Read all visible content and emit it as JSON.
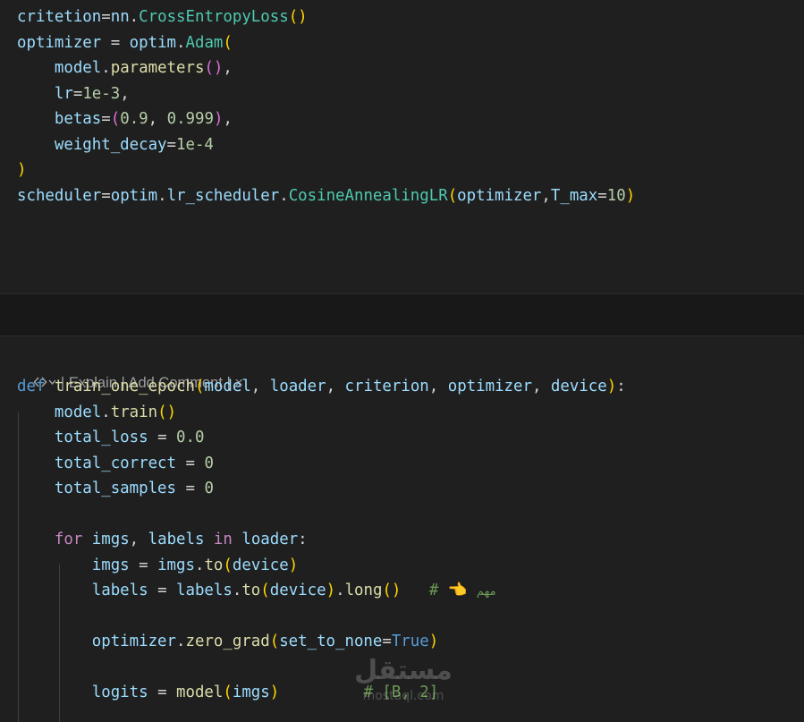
{
  "top_cell": {
    "lines": [
      [
        [
          "v",
          "critetion"
        ],
        [
          "p",
          "="
        ],
        [
          "v",
          "nn"
        ],
        [
          "p",
          "."
        ],
        [
          "c",
          "CrossEntropyLoss"
        ],
        [
          "b1",
          "()"
        ]
      ],
      [
        [
          "v",
          "optimizer"
        ],
        [
          "p",
          " = "
        ],
        [
          "v",
          "optim"
        ],
        [
          "p",
          "."
        ],
        [
          "c",
          "Adam"
        ],
        [
          "b1",
          "("
        ]
      ],
      [
        [
          "p",
          "    "
        ],
        [
          "v",
          "model"
        ],
        [
          "p",
          "."
        ],
        [
          "f",
          "parameters"
        ],
        [
          "b2",
          "()"
        ],
        [
          "p",
          ","
        ]
      ],
      [
        [
          "p",
          "    "
        ],
        [
          "v",
          "lr"
        ],
        [
          "p",
          "="
        ],
        [
          "n",
          "1e-3"
        ],
        [
          "p",
          ","
        ]
      ],
      [
        [
          "p",
          "    "
        ],
        [
          "v",
          "betas"
        ],
        [
          "p",
          "="
        ],
        [
          "b2",
          "("
        ],
        [
          "n",
          "0.9"
        ],
        [
          "p",
          ", "
        ],
        [
          "n",
          "0.999"
        ],
        [
          "b2",
          ")"
        ],
        [
          "p",
          ","
        ]
      ],
      [
        [
          "p",
          "    "
        ],
        [
          "v",
          "weight_decay"
        ],
        [
          "p",
          "="
        ],
        [
          "n",
          "1e-4"
        ]
      ],
      [
        [
          "b1",
          ")"
        ]
      ],
      [
        [
          "v",
          "scheduler"
        ],
        [
          "p",
          "="
        ],
        [
          "v",
          "optim"
        ],
        [
          "p",
          "."
        ],
        [
          "v",
          "lr_scheduler"
        ],
        [
          "p",
          "."
        ],
        [
          "c",
          "CosineAnnealingLR"
        ],
        [
          "b1",
          "("
        ],
        [
          "v",
          "optimizer"
        ],
        [
          "p",
          ","
        ],
        [
          "v",
          "T_max"
        ],
        [
          "p",
          "="
        ],
        [
          "n",
          "10"
        ],
        [
          "b1",
          ")"
        ]
      ]
    ]
  },
  "codelens": {
    "icon": "code-compare-icon",
    "separator": " | ",
    "explain_label": "Explain",
    "add_comment_label": "Add Comment",
    "close_glyph": "×"
  },
  "bottom_cell": {
    "lines": [
      [
        [
          "k",
          "def "
        ],
        [
          "f",
          "train_one_epoch"
        ],
        [
          "b1",
          "("
        ],
        [
          "v",
          "model"
        ],
        [
          "p",
          ", "
        ],
        [
          "v",
          "loader"
        ],
        [
          "p",
          ", "
        ],
        [
          "v",
          "criterion"
        ],
        [
          "p",
          ", "
        ],
        [
          "v",
          "optimizer"
        ],
        [
          "p",
          ", "
        ],
        [
          "v",
          "device"
        ],
        [
          "b1",
          ")"
        ],
        [
          "p",
          ":"
        ]
      ],
      [
        [
          "p",
          "    "
        ],
        [
          "v",
          "model"
        ],
        [
          "p",
          "."
        ],
        [
          "f",
          "train"
        ],
        [
          "b1",
          "()"
        ]
      ],
      [
        [
          "p",
          "    "
        ],
        [
          "v",
          "total_loss"
        ],
        [
          "p",
          " = "
        ],
        [
          "n",
          "0.0"
        ]
      ],
      [
        [
          "p",
          "    "
        ],
        [
          "v",
          "total_correct"
        ],
        [
          "p",
          " = "
        ],
        [
          "n",
          "0"
        ]
      ],
      [
        [
          "p",
          "    "
        ],
        [
          "v",
          "total_samples"
        ],
        [
          "p",
          " = "
        ],
        [
          "n",
          "0"
        ]
      ],
      [],
      [
        [
          "p",
          "    "
        ],
        [
          "kc",
          "for "
        ],
        [
          "v",
          "imgs"
        ],
        [
          "p",
          ", "
        ],
        [
          "v",
          "labels"
        ],
        [
          "kc",
          " in "
        ],
        [
          "v",
          "loader"
        ],
        [
          "p",
          ":"
        ]
      ],
      [
        [
          "p",
          "        "
        ],
        [
          "v",
          "imgs"
        ],
        [
          "p",
          " = "
        ],
        [
          "v",
          "imgs"
        ],
        [
          "p",
          "."
        ],
        [
          "f",
          "to"
        ],
        [
          "b1",
          "("
        ],
        [
          "v",
          "device"
        ],
        [
          "b1",
          ")"
        ]
      ],
      [
        [
          "p",
          "        "
        ],
        [
          "v",
          "labels"
        ],
        [
          "p",
          " = "
        ],
        [
          "v",
          "labels"
        ],
        [
          "p",
          "."
        ],
        [
          "f",
          "to"
        ],
        [
          "b1",
          "("
        ],
        [
          "v",
          "device"
        ],
        [
          "b1",
          ")"
        ],
        [
          "p",
          "."
        ],
        [
          "f",
          "long"
        ],
        [
          "b1",
          "()"
        ],
        [
          "p",
          "   "
        ],
        [
          "cm",
          "# "
        ],
        [
          "emoji",
          "👈"
        ],
        [
          "p",
          " "
        ],
        [
          "arabic",
          "مهم"
        ]
      ],
      [],
      [
        [
          "p",
          "        "
        ],
        [
          "v",
          "optimizer"
        ],
        [
          "p",
          "."
        ],
        [
          "f",
          "zero_grad"
        ],
        [
          "b1",
          "("
        ],
        [
          "v",
          "set_to_none"
        ],
        [
          "p",
          "="
        ],
        [
          "k",
          "True"
        ],
        [
          "b1",
          ")"
        ]
      ],
      [],
      [
        [
          "p",
          "        "
        ],
        [
          "v",
          "logits"
        ],
        [
          "p",
          " = "
        ],
        [
          "f",
          "model"
        ],
        [
          "b1",
          "("
        ],
        [
          "v",
          "imgs"
        ],
        [
          "b1",
          ")"
        ],
        [
          "p",
          "         "
        ],
        [
          "cm",
          "# [B, 2]"
        ]
      ]
    ]
  },
  "watermark": {
    "arabic": "مستقل",
    "latin": "mostaql.com"
  }
}
